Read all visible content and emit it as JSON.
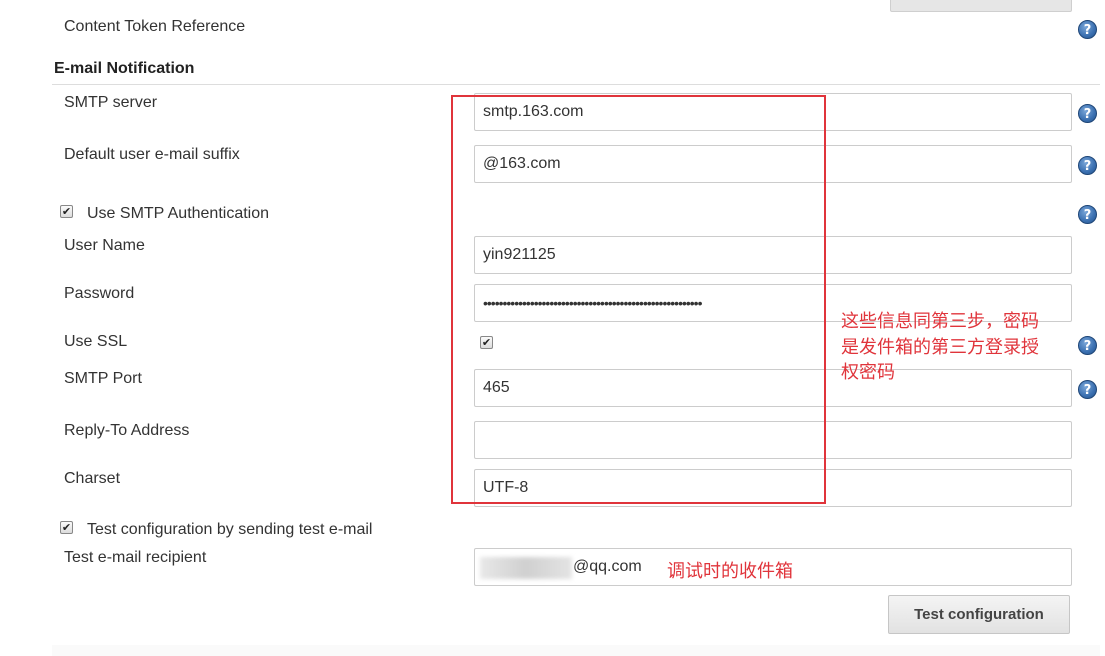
{
  "content_token_reference": "Content Token Reference",
  "section_title": "E-mail Notification",
  "fields": {
    "smtp_server": {
      "label": "SMTP server",
      "value": "smtp.163.com"
    },
    "default_suffix": {
      "label": "Default user e-mail suffix",
      "value": "@163.com"
    },
    "use_smtp_auth": {
      "label": "Use SMTP Authentication",
      "checked": true
    },
    "user_name": {
      "label": "User Name",
      "value": "yin921125"
    },
    "password": {
      "label": "Password",
      "value": "••••••••••••••••••••••••••••••••••••••••••••••••••••••••"
    },
    "use_ssl": {
      "label": "Use SSL",
      "checked": true
    },
    "smtp_port": {
      "label": "SMTP Port",
      "value": "465"
    },
    "reply_to": {
      "label": "Reply-To Address",
      "value": ""
    },
    "charset": {
      "label": "Charset",
      "value": "UTF-8"
    },
    "test_config": {
      "label": "Test configuration by sending test e-mail",
      "checked": true
    },
    "test_recipient": {
      "label": "Test e-mail recipient",
      "value": "@qq.com"
    }
  },
  "annotations": {
    "info_line1": "这些信息同第三步，密码",
    "info_line2": "是发件箱的第三方登录授",
    "info_line3": "权密码",
    "recipient_note": "调试时的收件箱"
  },
  "test_button_label": "Test configuration",
  "help_glyph": "?",
  "check_glyph": "✔",
  "colors": {
    "annotation": "#e0343b",
    "help_icon": "#3a6fb0"
  }
}
